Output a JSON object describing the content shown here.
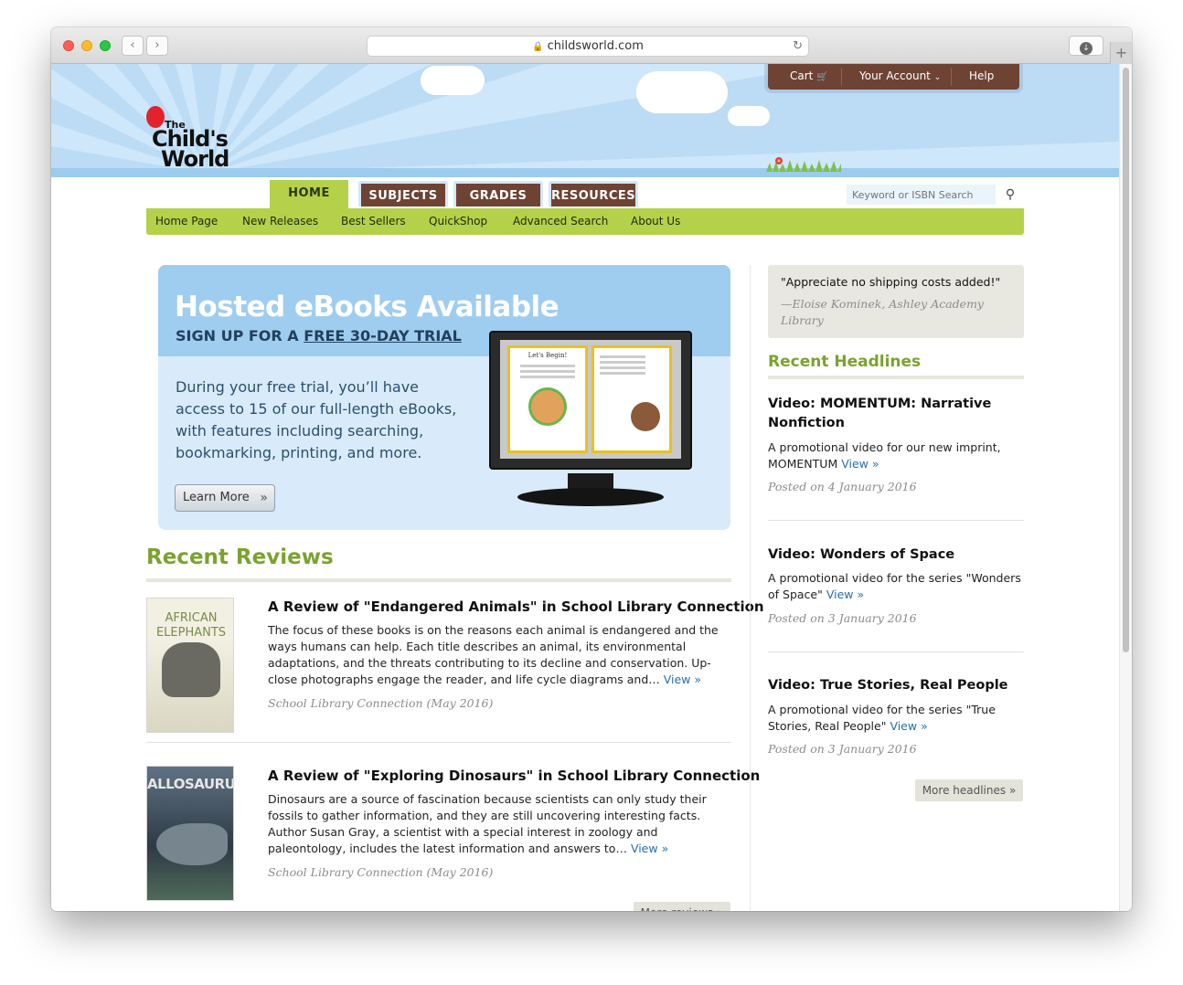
{
  "browser": {
    "url": "childsworld.com",
    "back": "‹",
    "forward": "›",
    "reload": "↻",
    "download": "↓",
    "new_tab": "+"
  },
  "top_menu": {
    "cart": "Cart",
    "cart_icon": "🛒",
    "account": "Your Account",
    "account_chevron": "⌄",
    "help": "Help"
  },
  "logo": {
    "the": "The",
    "child": "Child's",
    "world": "World"
  },
  "tabs": [
    "HOME",
    "SUBJECTS",
    "GRADES",
    "RESOURCES"
  ],
  "search": {
    "placeholder": "Keyword or ISBN Search",
    "icon": "⚲"
  },
  "subnav": [
    "Home Page",
    "New Releases",
    "Best Sellers",
    "QuickShop",
    "Advanced Search",
    "About Us"
  ],
  "banner": {
    "title": "Hosted eBooks Available",
    "sub_prefix": "SIGN UP FOR A ",
    "sub_link": "FREE 30-DAY TRIAL",
    "body": "During your free trial, you’ll have access to 15 of our full-length eBooks, with features including searching, bookmarking, printing, and more.",
    "button": "Learn More",
    "button_icon": "»",
    "page_left_title": "Let's Begin!"
  },
  "reviews": {
    "title": "Recent Reviews",
    "items": [
      {
        "cover_top": "",
        "cover_title": "AFRICAN ELEPHANTS",
        "title": "A Review of \"Endangered Animals\" in School Library Connection",
        "text": "The focus of these books is on the reasons each animal is endangered and the ways humans can help. Each title describes an animal, its environmental adaptations, and the threats contributing to its decline and conservation. Up-close photographs engage the reader, and life cycle diagrams and…",
        "view": "View »",
        "source": "School Library Connection (May 2016)"
      },
      {
        "cover_title": "ALLOSAURUS",
        "title": "A Review of \"Exploring Dinosaurs\" in School Library Connection",
        "text": "Dinosaurs are a source of fascination because scientists can only study their fossils to gather information, and they are still uncovering interesting facts. Author Susan Gray, a scientist with a special interest in zoology and paleontology, includes the latest information and answers to…",
        "view": "View »",
        "source": "School Library Connection (May 2016)"
      }
    ],
    "more": "More reviews »"
  },
  "sidebar": {
    "quote": "\"Appreciate no shipping costs added!\"",
    "quote_by": "—Eloise Kominek, Ashley Academy Library",
    "headlines_title": "Recent Headlines",
    "headlines": [
      {
        "title": "Video: MOMENTUM: Narrative Nonfiction",
        "text": "A promotional video for our new imprint, MOMENTUM",
        "view": "View »",
        "date": "Posted on 4 January 2016"
      },
      {
        "title": "Video: Wonders of Space",
        "text": "A promotional video for the series \"Wonders of Space\"",
        "view": "View »",
        "date": "Posted on 3 January 2016"
      },
      {
        "title": "Video: True Stories, Real People",
        "text": "A promotional video for the series \"True Stories, Real People\"",
        "view": "View »",
        "date": "Posted on 3 January 2016"
      }
    ],
    "more": "More headlines »"
  },
  "colors": {
    "brand_green": "#b5d14a",
    "brand_brown": "#6e4333",
    "heading_green": "#7aa32f",
    "link_blue": "#2670a8"
  }
}
